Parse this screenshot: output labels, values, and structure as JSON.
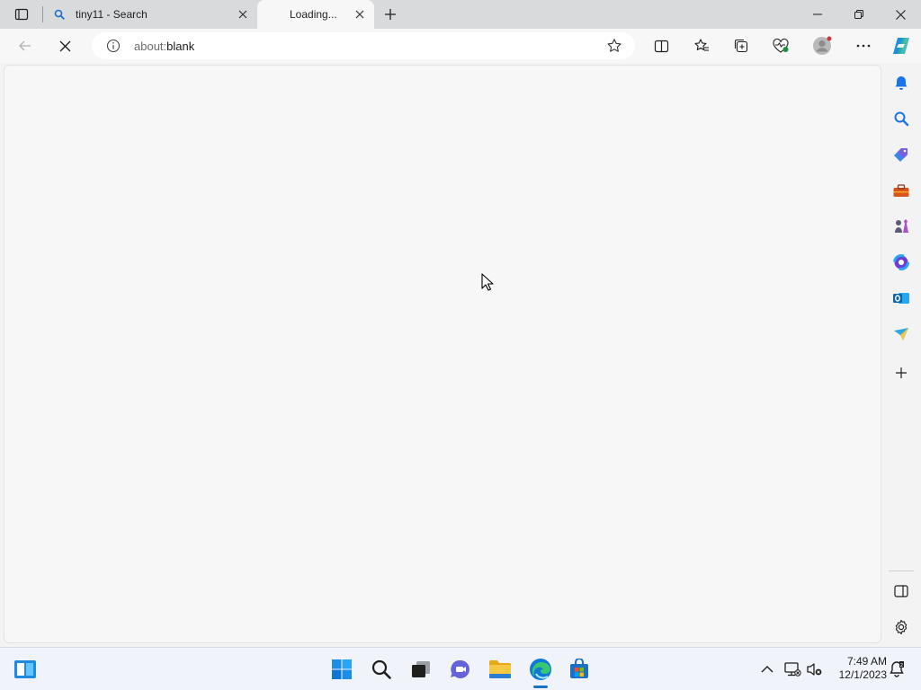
{
  "tabs": [
    {
      "title": "tiny11 - Search",
      "icon": "search-icon",
      "active": false
    },
    {
      "title": "Loading...",
      "icon": "loading-icon",
      "active": true
    }
  ],
  "toolbar": {
    "address_scheme": "about:",
    "address_path": "blank",
    "loading": true
  },
  "sidebar": {
    "items": [
      "bell-icon",
      "search-icon",
      "shopping-tag-icon",
      "tools-icon",
      "games-icon",
      "microsoft365-icon",
      "outlook-icon",
      "drop-icon",
      "add-icon"
    ],
    "bottom": [
      "hide-sidebar-icon",
      "settings-icon"
    ]
  },
  "taskbar": {
    "apps": [
      "start-icon",
      "search-icon",
      "task-view-icon",
      "chat-icon",
      "file-explorer-icon",
      "edge-icon",
      "store-icon"
    ],
    "clock_time": "7:49 AM",
    "clock_date": "12/1/2023"
  },
  "colors": {
    "accent": "#1a6fc9",
    "tabstrip": "#d9dadc",
    "content": "#f7f7f7"
  }
}
